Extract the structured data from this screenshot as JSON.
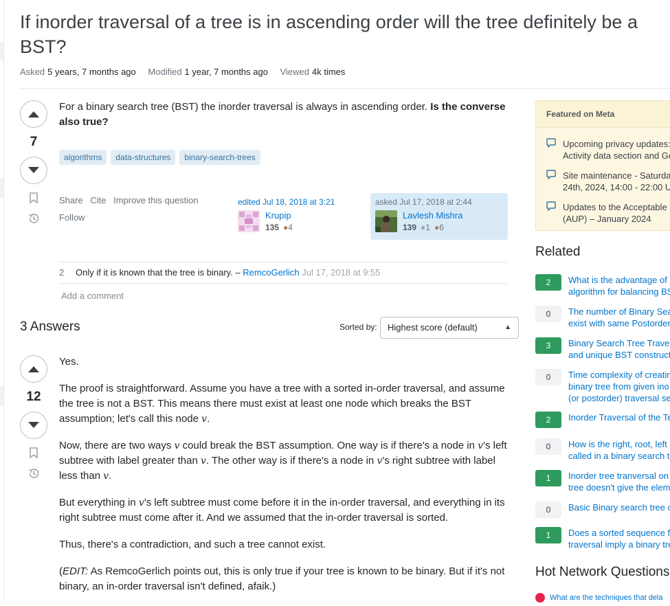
{
  "question": {
    "title": "If inorder traversal of a tree is in ascending order will the tree definitely be a BST?",
    "asked_label": "Asked",
    "asked_value": "5 years, 7 months ago",
    "modified_label": "Modified",
    "modified_value": "1 year, 7 months ago",
    "viewed_label": "Viewed",
    "viewed_value": "4k times",
    "score": "7",
    "body_plain": "For a binary search tree (BST) the inorder traversal is always in ascending order.",
    "body_bold": "Is the converse also true?",
    "tags": [
      "algorithms",
      "data-structures",
      "binary-search-trees"
    ],
    "actions": {
      "share": "Share",
      "cite": "Cite",
      "improve": "Improve this question",
      "follow": "Follow"
    },
    "editor": {
      "label": "edited Jul 18, 2018 at 3:21",
      "name": "Krupip",
      "rep": "135",
      "bronze": "4"
    },
    "asker": {
      "label": "asked Jul 17, 2018 at 2:44",
      "name": "Lavlesh Mishra",
      "rep": "139",
      "silver": "1",
      "bronze": "6"
    },
    "comment": {
      "score": "2",
      "text": "Only if it is known that the tree is binary. –",
      "user": "RemcoGerlich",
      "date": "Jul 17, 2018 at 9:55"
    },
    "add_comment": "Add a comment"
  },
  "answers_header": "3 Answers",
  "sort": {
    "label": "Sorted by:",
    "value": "Highest score (default)"
  },
  "answer": {
    "score": "12",
    "p1": "Yes.",
    "p2a": "The proof is straightforward. Assume you have a tree with a sorted in-order traversal, and assume the tree is not a BST. This means there must exist at least one node which breaks the BST assumption; let's call this node ",
    "var": "v",
    "p3a": "Now, there are two ways ",
    "p3b": " could break the BST assumption. One way is if there's a node in ",
    "p3c": "'s left subtree with label greater than ",
    "p3d": ". The other way is if there's a node in ",
    "p3e": "'s right subtree with label less than ",
    "p4a": "But everything in ",
    "p4b": "'s left subtree must come before it in the in-order traversal, and everything in its right subtree must come after it. And we assumed that the in-order traversal is sorted.",
    "p5": "Thus, there's a contradiction, and such a tree cannot exist.",
    "p6_em": "EDIT:",
    "p6": " As RemcoGerlich points out, this is only true if your tree is known to be binary. But if it's not binary, an in-order traversal isn't defined, afaik.)"
  },
  "sidebar": {
    "featured_title": "Featured on Meta",
    "featured": [
      "Upcoming privacy updates:\nActivity data section and Go",
      "Site maintenance - Saturda\n24th, 2024, 14:00 - 22:00 U",
      "Updates to the Acceptable U\n(AUP) – January 2024"
    ],
    "related_title": "Related",
    "related": [
      {
        "score": "2",
        "title": "What is the advantage of\nalgorithm for balancing BS"
      },
      {
        "score": "0",
        "title": "The number of Binary Sea\nexist with same Postorder"
      },
      {
        "score": "3",
        "title": "Binary Search Tree Trave\nand unique BST construct"
      },
      {
        "score": "0",
        "title": "Time complexity of creatin\nbinary tree from given ino\n(or postorder) traversal se"
      },
      {
        "score": "2",
        "title": "Inorder Traversal of the Te"
      },
      {
        "score": "0",
        "title": "How is the right, root, left\ncalled in a binary search t"
      },
      {
        "score": "1",
        "title": "Inorder tree tranversal on\ntree doesn't give the elem"
      },
      {
        "score": "0",
        "title": "Basic Binary search tree c"
      },
      {
        "score": "1",
        "title": "Does a sorted sequence f\ntraversal imply a binary tre"
      }
    ],
    "hnq_title": "Hot Network Questions",
    "hnq_first": "What are the techniques that dela"
  },
  "colors": {
    "accent": "#0074cc",
    "score_positive": "#2e9b5d",
    "tag_bg": "#e1ecf4",
    "featured_bg": "#fdf7e2"
  }
}
